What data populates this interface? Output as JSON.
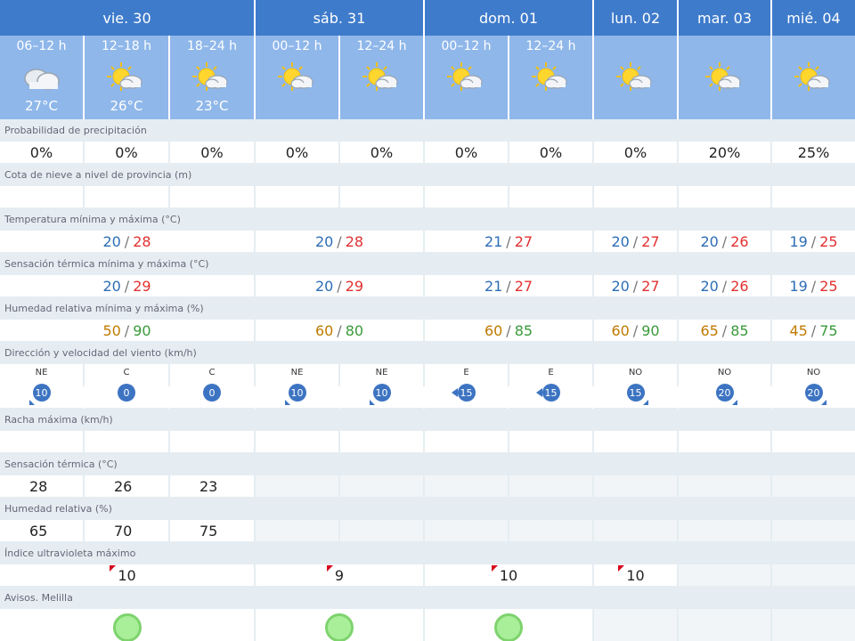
{
  "days": [
    {
      "label": "vie. 30",
      "span": 5
    },
    {
      "label": "sáb. 31",
      "span": 3
    },
    {
      "label": "dom. 01",
      "span": 3
    },
    {
      "label": "lun. 02",
      "span": 1
    },
    {
      "label": "mar. 03",
      "span": 1
    },
    {
      "label": "mié. 04",
      "span": 1
    }
  ],
  "periods": [
    {
      "label": "06–12 h",
      "icon": "cloudy-icon",
      "temp": "27°C"
    },
    {
      "label": "12–18 h",
      "icon": "sun-cloud-icon",
      "temp": "26°C"
    },
    {
      "label": "18–24 h",
      "icon": "sun-cloud-icon",
      "temp": "23°C"
    },
    {
      "label": "00–12 h",
      "icon": "sun-cloud-icon",
      "temp": ""
    },
    {
      "label": "12–24 h",
      "icon": "sun-cloud-icon",
      "temp": ""
    },
    {
      "label": "00–12 h",
      "icon": "sun-cloud-icon",
      "temp": ""
    },
    {
      "label": "12–24 h",
      "icon": "sun-cloud-icon",
      "temp": ""
    },
    {
      "label": "",
      "icon": "sun-cloud-icon",
      "temp": ""
    },
    {
      "label": "",
      "icon": "sun-cloud-icon",
      "temp": ""
    },
    {
      "label": "",
      "icon": "sun-cloud-icon",
      "temp": ""
    }
  ],
  "rows": {
    "precip": {
      "label": "Probabilidad de precipitación",
      "values": [
        "0%",
        "0%",
        "0%",
        "0%",
        "0%",
        "0%",
        "0%",
        "0%",
        "20%",
        "25%"
      ]
    },
    "snow": {
      "label": "Cota de nieve a nivel de provincia (m)",
      "values": [
        "",
        "",
        "",
        "",
        "",
        "",
        "",
        "",
        "",
        ""
      ]
    },
    "temp": {
      "label": "Temperatura mínima y máxima (°C)",
      "values": [
        [
          "20",
          "28"
        ],
        [
          "20",
          "28"
        ],
        [
          "21",
          "27"
        ],
        [
          "20",
          "27"
        ],
        [
          "20",
          "26"
        ],
        [
          "19",
          "25"
        ]
      ]
    },
    "feel": {
      "label": "Sensación térmica mínima y máxima (°C)",
      "values": [
        [
          "20",
          "29"
        ],
        [
          "20",
          "29"
        ],
        [
          "21",
          "27"
        ],
        [
          "20",
          "27"
        ],
        [
          "20",
          "26"
        ],
        [
          "19",
          "25"
        ]
      ]
    },
    "humidity": {
      "label": "Humedad relativa mínima y máxima (%)",
      "values": [
        [
          "50",
          "90"
        ],
        [
          "60",
          "80"
        ],
        [
          "60",
          "85"
        ],
        [
          "60",
          "90"
        ],
        [
          "65",
          "85"
        ],
        [
          "45",
          "75"
        ]
      ]
    },
    "wind": {
      "label": "Dirección y velocidad del viento (km/h)",
      "values": [
        {
          "dir": "NE",
          "speed": "10",
          "arrow": "sw"
        },
        {
          "dir": "C",
          "speed": "0",
          "arrow": ""
        },
        {
          "dir": "C",
          "speed": "0",
          "arrow": ""
        },
        {
          "dir": "NE",
          "speed": "10",
          "arrow": "sw"
        },
        {
          "dir": "NE",
          "speed": "10",
          "arrow": "sw"
        },
        {
          "dir": "E",
          "speed": "15",
          "arrow": "w"
        },
        {
          "dir": "E",
          "speed": "15",
          "arrow": "w"
        },
        {
          "dir": "NO",
          "speed": "15",
          "arrow": "se"
        },
        {
          "dir": "NO",
          "speed": "20",
          "arrow": "se"
        },
        {
          "dir": "NO",
          "speed": "20",
          "arrow": "se"
        }
      ]
    },
    "gust": {
      "label": "Racha máxima (km/h)",
      "values": [
        "",
        "",
        "",
        "",
        "",
        "",
        "",
        "",
        "",
        ""
      ]
    },
    "feel_now": {
      "label": "Sensación térmica (°C)",
      "values": [
        "28",
        "26",
        "23"
      ]
    },
    "rh": {
      "label": "Humedad relativa (%)",
      "values": [
        "65",
        "70",
        "75"
      ]
    },
    "uv": {
      "label": "Índice ultravioleta máximo",
      "values": [
        "10",
        "9",
        "10",
        "10",
        "",
        ""
      ]
    },
    "warnings": {
      "label": "Avisos. Melilla",
      "values": [
        "green",
        "green",
        "green",
        "",
        "",
        ""
      ]
    }
  },
  "colors": {
    "header_blue": "#3f7bcb",
    "period_blue": "#8fb7ea",
    "min_blue": "#2d6db5",
    "max_red": "#e23030",
    "warning_green": "#a9ef9a"
  }
}
